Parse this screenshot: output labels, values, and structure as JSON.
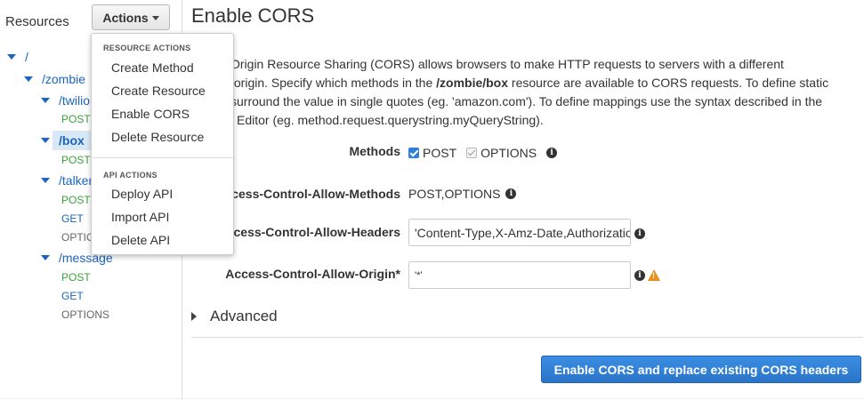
{
  "sidebar": {
    "title": "Resources",
    "actions_label": "Actions",
    "tree": [
      {
        "label": "/",
        "type": "resource"
      },
      {
        "label": "/zombie",
        "type": "resource"
      },
      {
        "label": "/twilio",
        "type": "resource"
      },
      {
        "label": "POST",
        "type": "method"
      },
      {
        "label": "/box",
        "type": "resource",
        "selected": true
      },
      {
        "label": "POST",
        "type": "method"
      },
      {
        "label": "/talker",
        "type": "resource"
      },
      {
        "label": "POST",
        "type": "method"
      },
      {
        "label": "GET",
        "type": "method"
      },
      {
        "label": "OPTIONS",
        "type": "method"
      },
      {
        "label": "/message",
        "type": "resource"
      },
      {
        "label": "POST",
        "type": "method"
      },
      {
        "label": "GET",
        "type": "method"
      },
      {
        "label": "OPTIONS",
        "type": "method"
      }
    ]
  },
  "dropdown": {
    "resource_header": "RESOURCE ACTIONS",
    "resource_items": [
      "Create Method",
      "Create Resource",
      "Enable CORS",
      "Delete Resource"
    ],
    "api_header": "API ACTIONS",
    "api_items": [
      "Deploy API",
      "Import API",
      "Delete API"
    ]
  },
  "main": {
    "title": "Enable CORS",
    "desc_line1": "Origin Resource Sharing (CORS) allows browsers to make HTTP requests to servers with a different",
    "desc_line2_a": "/origin. Specify which methods in the ",
    "desc_line2_b": "/zombie/box",
    "desc_line2_c": " resource are available to CORS requests. To define static",
    "desc_line3": "surround the value in single quotes (eg. 'amazon.com'). To define mappings use the syntax described in the",
    "desc_line4": "l Editor (eg. method.request.querystring.myQueryString).",
    "methods_label": "Methods",
    "method_post": "POST",
    "method_options": "OPTIONS",
    "allow_methods_label": "ccess-Control-Allow-Methods",
    "allow_methods_value": "POST,OPTIONS",
    "allow_headers_label": "ccess-Control-Allow-Headers",
    "allow_headers_value": "'Content-Type,X-Amz-Date,Authorization,X-Api-Key'",
    "allow_origin_label": "Access-Control-Allow-Origin*",
    "allow_origin_value": "'*'",
    "advanced_label": "Advanced",
    "submit_label": "Enable CORS and replace existing CORS headers"
  },
  "colors": {
    "link": "#1a64c2",
    "post": "#3aa03a",
    "primary": "#2a74c9",
    "warning": "#e8901a"
  }
}
